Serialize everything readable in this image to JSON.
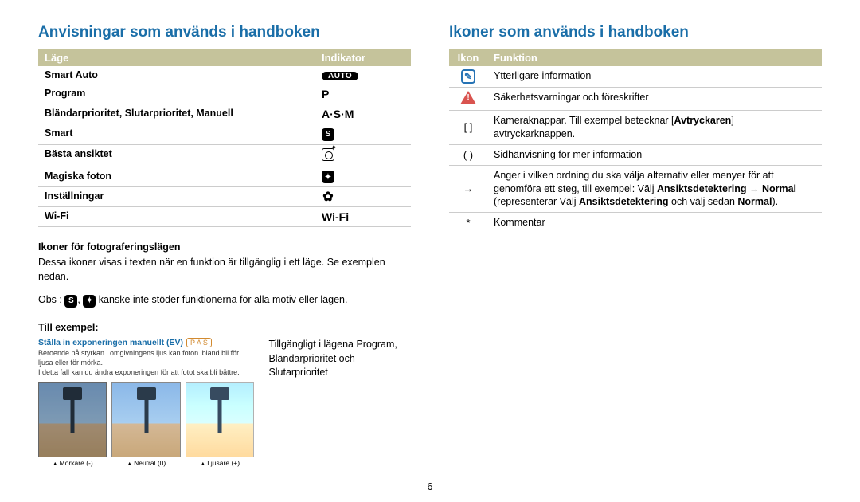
{
  "left": {
    "title": "Anvisningar som används i handboken",
    "table": {
      "headers": [
        "Läge",
        "Indikator"
      ],
      "rows": [
        {
          "mode": "Smart Auto",
          "indicator_type": "auto",
          "indicator_text": "AUTO"
        },
        {
          "mode": "Program",
          "indicator_type": "text",
          "indicator_text": "P"
        },
        {
          "mode": "Bländarprioritet, Slutarprioritet, Manuell",
          "indicator_type": "text",
          "indicator_text": "A·S·M"
        },
        {
          "mode": "Smart",
          "indicator_type": "square",
          "indicator_text": "S"
        },
        {
          "mode": "Bästa ansiktet",
          "indicator_type": "face",
          "indicator_text": ""
        },
        {
          "mode": "Magiska foton",
          "indicator_type": "square",
          "indicator_text": "✦"
        },
        {
          "mode": "Inställningar",
          "indicator_type": "gear",
          "indicator_text": "✿"
        },
        {
          "mode": "Wi-Fi",
          "indicator_type": "text",
          "indicator_text": "Wi-Fi"
        }
      ]
    },
    "sub1_title": "Ikoner för fotograferingslägen",
    "sub1_para": "Dessa ikoner visas i texten när en funktion är tillgänglig i ett läge. Se exemplen nedan.",
    "obs_prefix": "Obs :",
    "obs_suffix": " kanske inte stöder funktionerna för alla motiv eller lägen.",
    "example_title": "Till exempel:",
    "example": {
      "heading": "Ställa in exponeringen manuellt (EV)",
      "badge": "P A S",
      "desc1": "Beroende på styrkan i omgivningens ljus kan foton ibland bli för ljusa eller för mörka.",
      "desc2": "I detta fall kan du ändra exponeringen för att fotot ska bli bättre.",
      "thumbs": [
        "Mörkare (-)",
        "Neutral (0)",
        "Ljusare (+)"
      ]
    },
    "callout": "Tillgängligt i lägena Program, Bländarprioritet och Slutarprioritet"
  },
  "right": {
    "title": "Ikoner som används i handboken",
    "table": {
      "headers": [
        "Ikon",
        "Funktion"
      ],
      "rows": [
        {
          "icon_type": "info",
          "text": "Ytterligare information"
        },
        {
          "icon_type": "warn",
          "text": "Säkerhetsvarningar och föreskrifter"
        },
        {
          "icon_type": "brackets",
          "icon_text": "[     ]",
          "text_html": "Kameraknappar. Till exempel betecknar [<b>Avtryckaren</b>] avtryckarknappen."
        },
        {
          "icon_type": "paren",
          "icon_text": "(     )",
          "text": "Sidhänvisning för mer information"
        },
        {
          "icon_type": "arrow",
          "icon_text": "→",
          "text_html": "Anger i vilken ordning du ska välja alternativ eller menyer för att genomföra ett steg, till exempel: Välj <b>Ansiktsdetektering</b> → <b>Normal</b> (representerar Välj <b>Ansiktsdetektering</b> och välj sedan <b>Normal</b>)."
        },
        {
          "icon_type": "star",
          "icon_text": "*",
          "text": "Kommentar"
        }
      ]
    }
  },
  "page": "6"
}
